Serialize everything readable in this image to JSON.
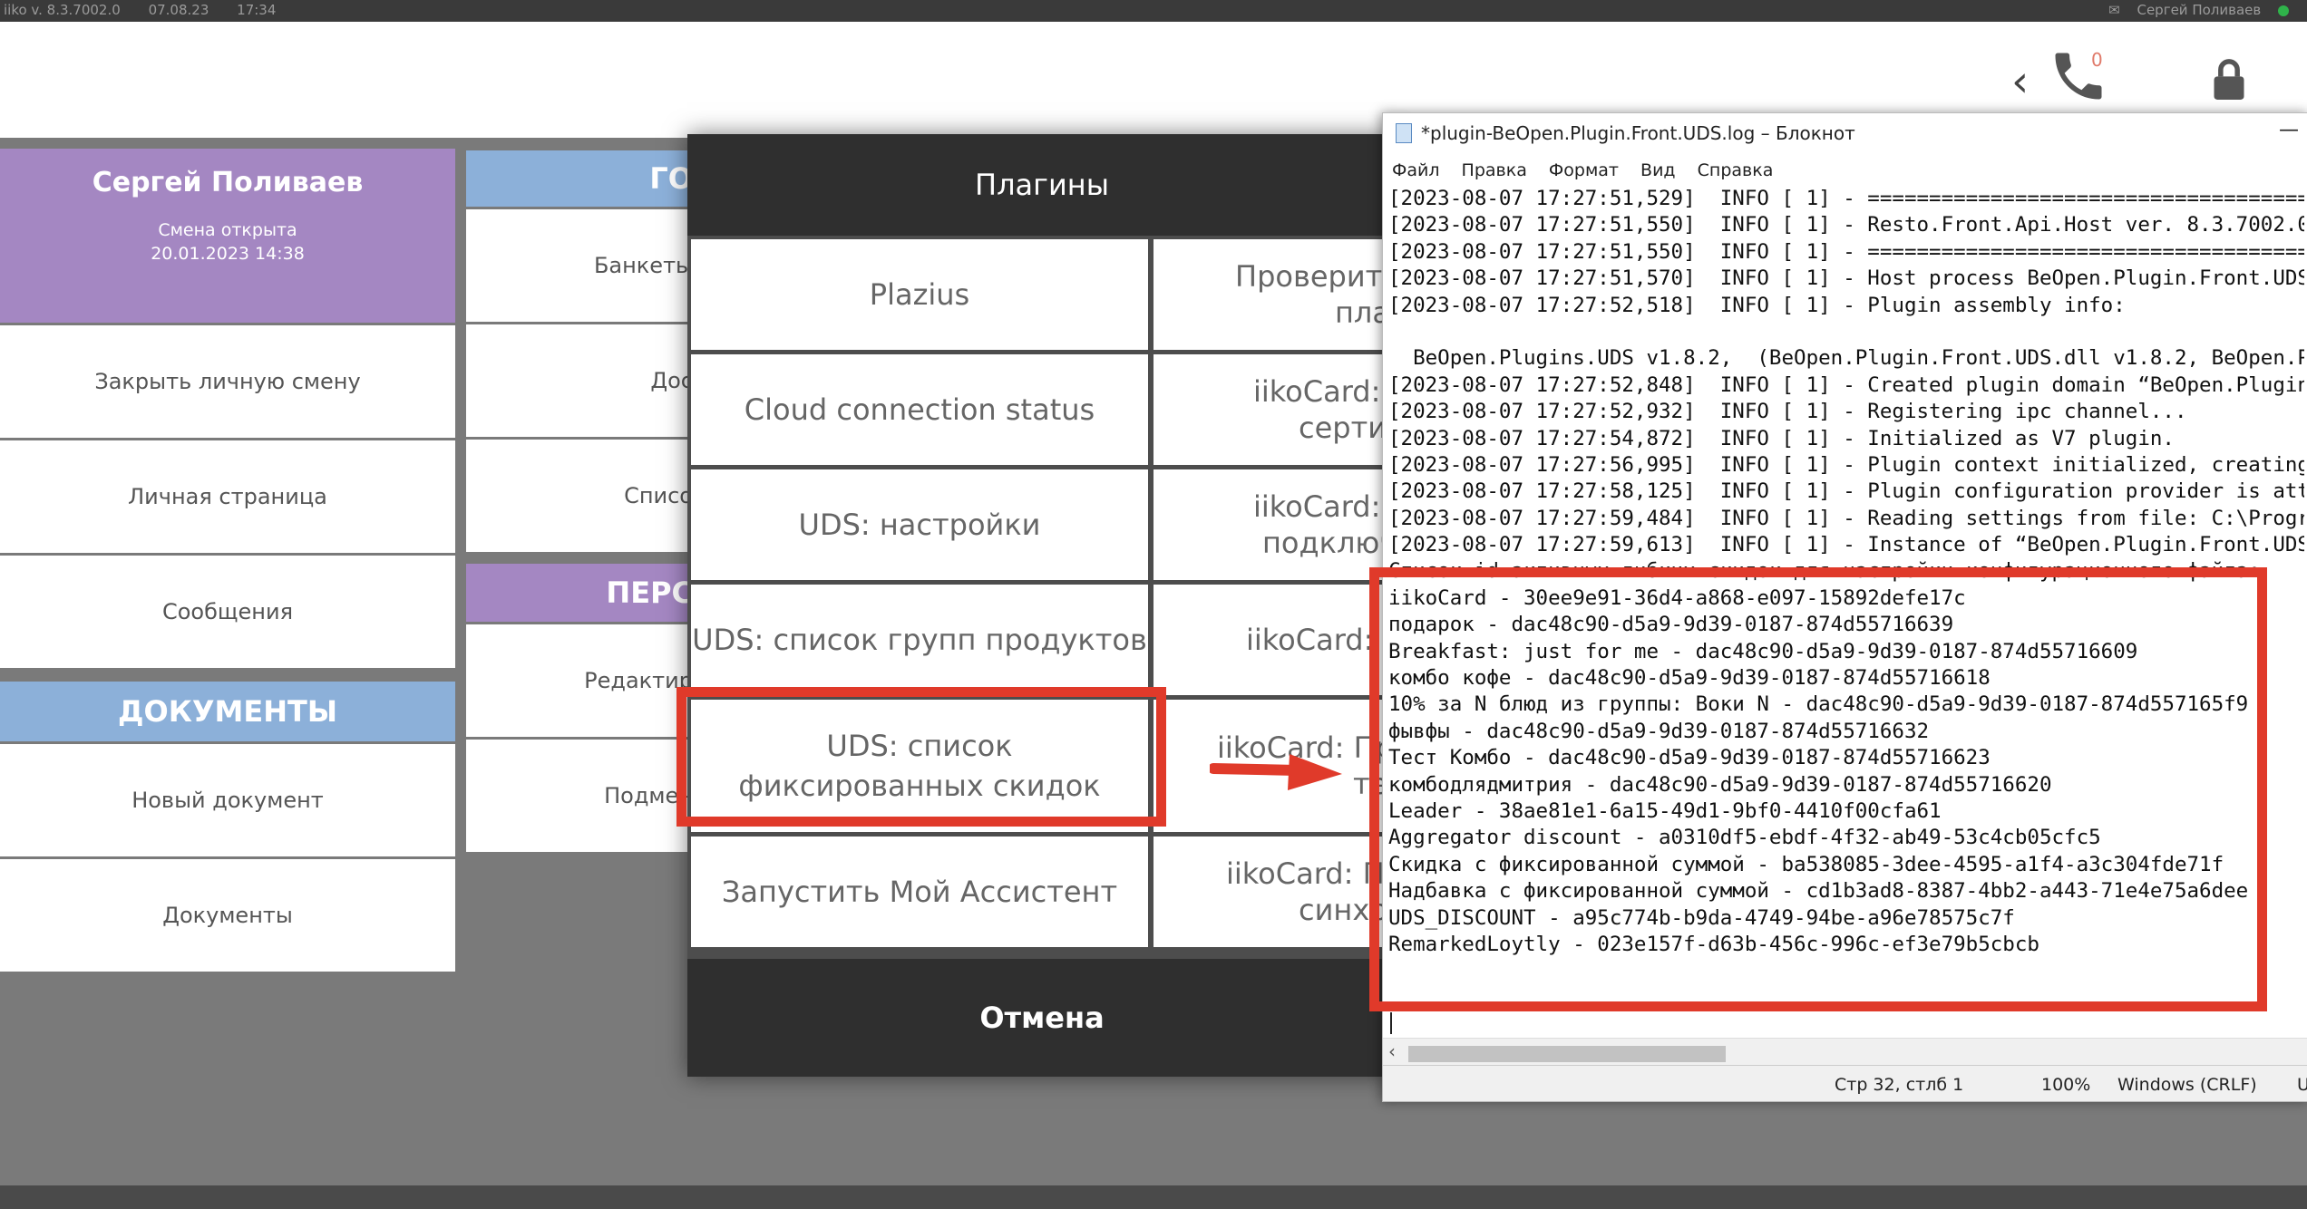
{
  "topbar": {
    "app_version": "iiko v. 8.3.7002.0",
    "date": "07.08.23",
    "time": "17:34",
    "user": "Сергей Поливаев"
  },
  "header": {
    "missed_calls": "0"
  },
  "user_card": {
    "name": "Сергей Поливаев",
    "shift_status": "Смена открыта",
    "shift_datetime": "20.01.2023 14:38"
  },
  "left_menu": {
    "items": [
      "Закрыть личную смену",
      "Личная страница",
      "Сообщения"
    ],
    "documents_header": "ДОКУМЕНТЫ",
    "documents_items": [
      "Новый документ",
      "Документы"
    ]
  },
  "middle_col": {
    "header1": "ГО",
    "items1": [
      "Банкеты",
      "Дос",
      "Списо"
    ],
    "header2": "ПЕРС",
    "items2": [
      "Редактир",
      "Подмен"
    ]
  },
  "plugins_dialog": {
    "title": "Плагины",
    "left_tiles": [
      "Plazius",
      "Cloud connection status",
      "UDS: настройки",
      "UDS: список групп продуктов",
      "UDS: список фиксированных скидок",
      "Запустить Мой Ассистент"
    ],
    "right_tiles": [
      [
        "Проверить",
        "плаг"
      ],
      [
        "iikoCard: А",
        "сертиф"
      ],
      [
        "iikoCard: Д",
        "подключ"
      ],
      [
        "iikoCard: За"
      ],
      [
        "iikoCard: При",
        "теле"
      ],
      [
        "iikoCard: Пр",
        "синхро"
      ]
    ],
    "cancel": "Отмена"
  },
  "notepad": {
    "title": "*plugin-BeOpen.Plugin.Front.UDS.log – Блокнот",
    "menu": [
      "Файл",
      "Правка",
      "Формат",
      "Вид",
      "Справка"
    ],
    "lines": [
      "[2023-08-07 17:27:51,529]  INFO [ 1] - =====================================",
      "[2023-08-07 17:27:51,550]  INFO [ 1] - Resto.Front.Api.Host ver. 8.3.7002.0",
      "[2023-08-07 17:27:51,550]  INFO [ 1] - =====================================",
      "[2023-08-07 17:27:51,570]  INFO [ 1] - Host process BeOpen.Plugin.Front.UDS",
      "[2023-08-07 17:27:52,518]  INFO [ 1] - Plugin assembly info:",
      "",
      "  BeOpen.Plugins.UDS v1.8.2,  (BeOpen.Plugin.Front.UDS.dll v1.8.2, BeOpen.Pl",
      "[2023-08-07 17:27:52,848]  INFO [ 1] - Created plugin domain “BeOpen.Plugin.",
      "[2023-08-07 17:27:52,932]  INFO [ 1] - Registering ipc channel...",
      "[2023-08-07 17:27:54,872]  INFO [ 1] - Initialized as V7 plugin.",
      "[2023-08-07 17:27:56,995]  INFO [ 1] - Plugin context initialized, creating",
      "[2023-08-07 17:27:58,125]  INFO [ 1] - Plugin configuration provider is atta",
      "[2023-08-07 17:27:59,484]  INFO [ 1] - Reading settings from file: C:\\Progra",
      "[2023-08-07 17:27:59,613]  INFO [ 1] - Instance of “BeOpen.Plugin.Front.UDS.",
      "Список id активных гибких скидок для настройки конфигурационного файла:",
      "iikoCard - 30ee9e91-36d4-a868-e097-15892defe17c",
      "подарок - dac48c90-d5a9-9d39-0187-874d55716639",
      "Breakfast: just for me - dac48c90-d5a9-9d39-0187-874d55716609",
      "комбо кофе - dac48c90-d5a9-9d39-0187-874d55716618",
      "10% за N блюд из группы: Воки N - dac48c90-d5a9-9d39-0187-874d557165f9",
      "фывфы - dac48c90-d5a9-9d39-0187-874d55716632",
      "Тест Комбо - dac48c90-d5a9-9d39-0187-874d55716623",
      "комбодлядмитрия - dac48c90-d5a9-9d39-0187-874d55716620",
      "Leader - 38ae81e1-6a15-49d1-9bf0-4410f00cfa61",
      "Aggregator discount - a0310df5-ebdf-4f32-ab49-53c4cb05cfc5",
      "Скидка с фиксированной суммой - ba538085-3dee-4595-a1f4-a3c304fde71f",
      "Надбавка с фиксированной суммой - cd1b3ad8-8387-4bb2-a443-71e4e75a6dee",
      "UDS_DISCOUNT - a95c774b-b9da-4749-94be-a96e78575c7f",
      "RemarkedLoytly - 023e157f-d63b-456c-996c-ef3e79b5cbcb"
    ],
    "status_position": "Стр 32, стлб 1",
    "status_zoom": "100%",
    "status_eol": "Windows (CRLF)",
    "status_enc": "U"
  },
  "colors": {
    "accent_red": "#e03a2a",
    "user_purple": "#a487c2",
    "section_blue": "#8cb0d9"
  }
}
